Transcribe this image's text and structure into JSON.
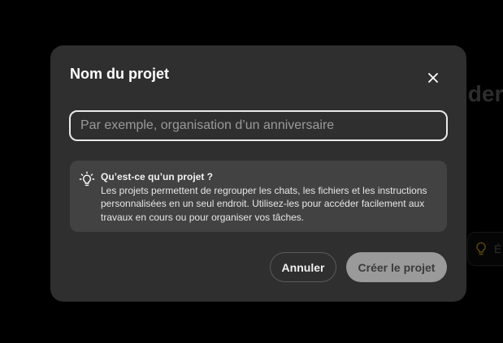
{
  "background": {
    "heading_fragment": "ider",
    "chip_fragment": "É"
  },
  "modal": {
    "title": "Nom du projet",
    "close_icon": "close-icon",
    "input": {
      "value": "",
      "placeholder": "Par exemple, organisation d’un anniversaire"
    },
    "info": {
      "icon": "lightbulb-icon",
      "title": "Qu’est-ce qu’un projet ?",
      "body": "Les projets permettent de regrouper les chats, les fichiers et les instructions personnalisées en un seul endroit. Utilisez-les pour accéder facilement aux travaux en cours ou pour organiser vos tâches."
    },
    "buttons": {
      "cancel_label": "Annuler",
      "create_label": "Créer le projet"
    }
  },
  "colors": {
    "page_bg": "#000000",
    "modal_bg": "#2f2f2f",
    "info_bg": "#424242",
    "create_button_bg": "#9a9a9a",
    "bulb_accent": "#b8900a"
  }
}
